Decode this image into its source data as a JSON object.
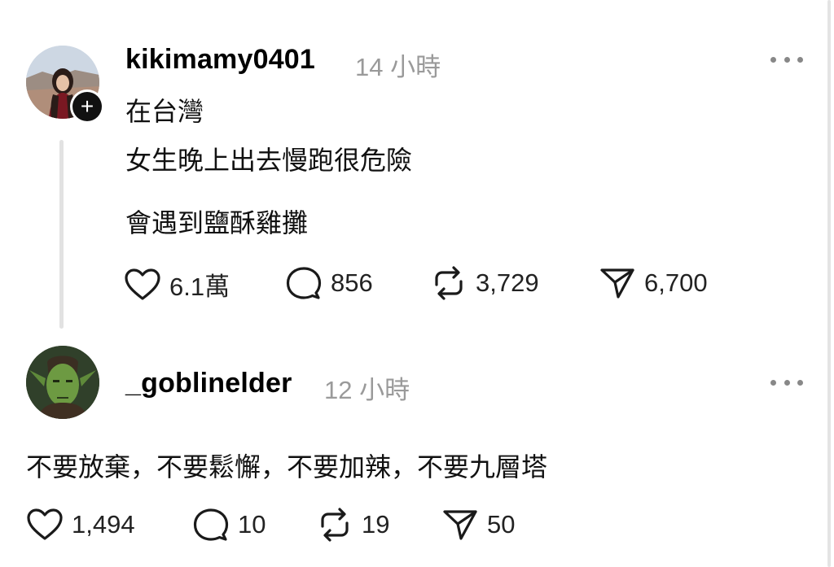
{
  "posts": [
    {
      "username": "kikimamy0401",
      "time": "14 小時",
      "lines": [
        "在台灣",
        "女生晚上出去慢跑很危險",
        "會遇到鹽酥雞攤"
      ],
      "stats": {
        "likes": "6.1萬",
        "comments": "856",
        "reposts": "3,729",
        "shares": "6,700"
      },
      "avatar_icon": "avatar-photo-woman",
      "follow_icon": "plus-icon"
    },
    {
      "username": "_goblinelder",
      "time": "12 小時",
      "lines": [
        "不要放棄，不要鬆懈，不要加辣，不要九層塔"
      ],
      "stats": {
        "likes": "1,494",
        "comments": "10",
        "reposts": "19",
        "shares": "50"
      },
      "avatar_icon": "avatar-goblin"
    }
  ],
  "icons": {
    "like": "heart-icon",
    "comment": "comment-bubble-icon",
    "repost": "repost-icon",
    "share": "send-icon",
    "more": "more-dots-icon"
  },
  "colors": {
    "text": "#000000",
    "muted": "#9a9a9a",
    "thread_line": "#e2e2e2",
    "icon_stroke": "#1a1a1a"
  }
}
